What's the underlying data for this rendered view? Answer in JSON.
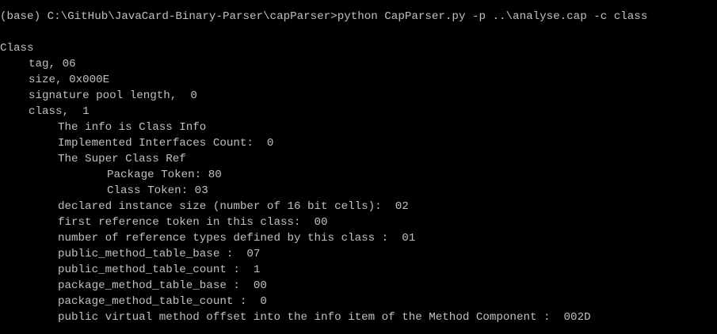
{
  "console": {
    "prompt_line": "(base) C:\\GitHub\\JavaCard-Binary-Parser\\capParser>python CapParser.py -p ..\\analyse.cap -c class",
    "output": [
      {
        "text": "Class",
        "level": 0
      },
      {
        "text": "tag, 06",
        "level": 1
      },
      {
        "text": "size, 0x000E",
        "level": 1
      },
      {
        "text": "signature pool length,  0",
        "level": 1
      },
      {
        "text": "class,  1",
        "level": 1
      },
      {
        "text": "The info is Class Info",
        "level": 2
      },
      {
        "text": "Implemented Interfaces Count:  0",
        "level": 2
      },
      {
        "text": "The Super Class Ref",
        "level": 2
      },
      {
        "text": "Package Token: 80",
        "level": 3
      },
      {
        "text": "Class Token: 03",
        "level": 3
      },
      {
        "text": "declared instance size (number of 16 bit cells):  02",
        "level": 2
      },
      {
        "text": "first reference token in this class:  00",
        "level": 2
      },
      {
        "text": "number of reference types defined by this class :  01",
        "level": 2
      },
      {
        "text": "public_method_table_base :  07",
        "level": 2
      },
      {
        "text": "public_method_table_count :  1",
        "level": 2
      },
      {
        "text": "package_method_table_base :  00",
        "level": 2
      },
      {
        "text": "package_method_table_count :  0",
        "level": 2
      },
      {
        "text": "public virtual method offset into the info item of the Method Component :  002D",
        "level": 2
      }
    ]
  },
  "colors": {
    "background": "#000000",
    "text": "#c0c0c0"
  }
}
